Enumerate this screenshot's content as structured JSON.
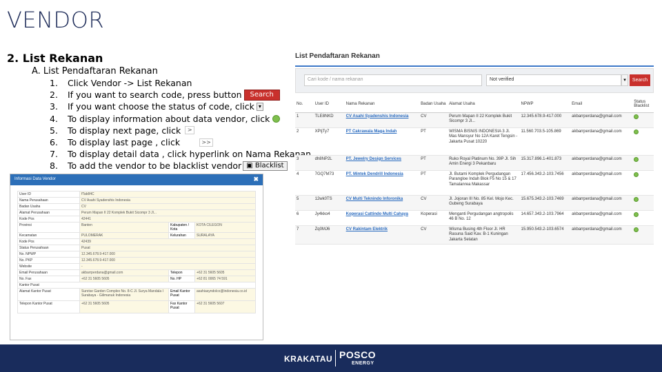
{
  "slide": {
    "title": "VENDOR",
    "section": "2.  List Rekanan",
    "subsection": "A.   List Pendaftaran Rekanan"
  },
  "steps": [
    {
      "num": "1.",
      "text": "Click Vendor -> List Rekanan"
    },
    {
      "num": "2.",
      "text": "If you want to search code, press button",
      "widget": "Search"
    },
    {
      "num": "3.",
      "text": "If you want choose the status of code, click",
      "widget": "▾"
    },
    {
      "num": "4.",
      "text": "To display information about data vendor, click"
    },
    {
      "num": "5.",
      "text": "To display next page, click",
      "widget": ">"
    },
    {
      "num": "6.",
      "text": "To display last page , click",
      "widget": ">>"
    },
    {
      "num": "7.",
      "text": "To display detail data , click hyperlink on Nama Rekanan"
    },
    {
      "num": "8.",
      "text": "To add the vendor to be blacklist vendor",
      "widget": "Blacklist"
    }
  ],
  "panel": {
    "title": "List Pendaftaran Rekanan",
    "search_placeholder": "Cari kode / nama rekanan",
    "status_value": "Not verified",
    "caret": "▾",
    "search_label": "Search",
    "columns": [
      "No.",
      "User ID",
      "Nama Rekanan",
      "Badan Usaha",
      "Alamat Usaha",
      "NPWP",
      "Email",
      "Status Blacklist"
    ],
    "rows": [
      {
        "no": "1",
        "user": "TLE8NKD",
        "nama": "CV Asahi Syadenshis Indonesia",
        "badan": "CV",
        "alamat": "Perum Mapan II 22 Komplek Bukit Sicompr 3 Jl...",
        "npwp": "12.345.678.9-417.000",
        "email": "akbarrperdana@gmail.com"
      },
      {
        "no": "2",
        "user": "XPtjTy7",
        "nama": "PT Cakrawala Maga Indah",
        "badan": "PT",
        "alamat": "WISMA BISNIS INDONESIA 3 Jl. Mas Mansyur No 12A Karet Tengsin - Jakarta Pusat 10220",
        "npwp": "11.560.703.5-105.869",
        "email": "akbarrperdana@gmail.com"
      },
      {
        "no": "3",
        "user": "dh8NP2L",
        "nama": "PT. Jewelry Design Services",
        "badan": "PT",
        "alamat": "Ruko Royal Platinum No. 39P Jl. Sih Amin Energi 3 Pekanbaru",
        "npwp": "15.317.896.1-401.873",
        "email": "akbarrperdana@gmail.com"
      },
      {
        "no": "4",
        "user": "7GQ7M73",
        "nama": "PT. Mintek Dendrill Indonesia",
        "badan": "PT",
        "alamat": "Jl. Butami Komplek Pergudangan Parangloe Indah Blok F5 No 15 & 17 Tamalanrea Makassar",
        "npwp": "17.456.343.2-103.7456",
        "email": "akbarrperdana@gmail.com"
      },
      {
        "no": "5",
        "user": "12wk0TS",
        "nama": "CV Multi Teknindo Inforonika",
        "badan": "CV",
        "alamat": "Jl. Jojoran III No. 85 Kel. Mojo Kec. Gubeng Surabaya",
        "npwp": "15.675.343.2-103.7469",
        "email": "akbarrperdana@gmail.com"
      },
      {
        "no": "6",
        "user": "Jy4kko4",
        "nama": "Koperasi Cattindo Multi Cahaya",
        "badan": "Koperasi",
        "alamat": "Menganti Pergudangan angtropolis 46 B No. 12",
        "npwp": "14.657.343.2-103.7964",
        "email": "akbarrperdana@gmail.com"
      },
      {
        "no": "7",
        "user": "Zq0MJ6",
        "nama": "CV Rakintam Elektrik",
        "badan": "CV",
        "alamat": "Wisma Busing 4th Floor Jl. HR Rasuna Said Kav. B-1 Kuningan Jakarta Selatan",
        "npwp": "15.950.543.2-103.6574",
        "email": "akbarrperdana@gmail.com"
      }
    ]
  },
  "modal": {
    "title": "Informasi Data Vendor",
    "close": "✖",
    "rows": [
      {
        "k": "User ID",
        "v": "fTab84C"
      },
      {
        "k": "Nama Perusahaan",
        "v": "CV Asahi Syadenshis Indonesia"
      },
      {
        "k": "Badan Usaha",
        "v": "CV"
      },
      {
        "k": "Alamat Perusahaan",
        "v": "Perum Mapan II 22 Komplek Bukit Sicompr 3 Jl..."
      },
      {
        "k": "Kode Pos",
        "v": "42441"
      },
      {
        "k": "Provinsi",
        "v": "Banten",
        "k2": "Kabupaten / Kota",
        "v2": "KOTA CILEGON"
      },
      {
        "k": "Kecamatan",
        "v": "PULOMERAK",
        "k2": "Kelurahan",
        "v2": "SURALAYA"
      },
      {
        "k": "Kode Pos",
        "v": "42439"
      },
      {
        "k": "Status Perusahaan",
        "v": "Pusat"
      },
      {
        "k": "No. NPWP",
        "v": "12.345.678.9-417.000"
      },
      {
        "k": "No. PKP",
        "v": "12.345.678.9-417.000"
      },
      {
        "k": "Website",
        "v": "-"
      },
      {
        "k": "Email Perusahaan",
        "v": "akbarrperdana@gmail.com",
        "k2": "Telepon",
        "v2": "+62 31 5605 5605"
      },
      {
        "k": "No. Fax",
        "v": "+62 31 5605 5605",
        "k2": "No. HP",
        "v2": "+62 81 0065 74 591"
      },
      {
        "k": "Kantor Pusat",
        "v": ""
      },
      {
        "k": "Alamat Kantor Pusat",
        "v": "Sunrise Garden Complex No. 8-C Jl. Surya Mandala I Surabaya - Gilimanuk Indonesia",
        "k2": "Email Kantor Pusat",
        "v2": "asahiasyndolco@indonesia.co.id"
      },
      {
        "k": "Telepon Kantor Pusat",
        "v": "+62 31 5605 5605",
        "k2": "Fax Kantor Pusat",
        "v2": "+62 31 5605 5607"
      }
    ]
  },
  "footer": {
    "brand1": "KRAKATAU",
    "brand2": "POSCO",
    "brand3": "ENERGY"
  }
}
